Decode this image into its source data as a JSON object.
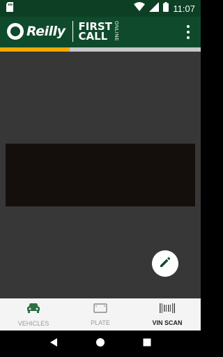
{
  "status_bar": {
    "time": "11:07"
  },
  "app_bar": {
    "logo_text": "Reilly",
    "first_line": "FIRST",
    "second_line": "CALL",
    "online_text": "ONLINE"
  },
  "bottom_nav": {
    "items": [
      {
        "label": "VEHICLES",
        "active": false
      },
      {
        "label": "PLATE",
        "active": false
      },
      {
        "label": "VIN SCAN",
        "active": true
      }
    ]
  },
  "colors": {
    "brand_green": "#0f4a2c",
    "accent_yellow": "#f4a900",
    "camera_bg": "#373737"
  },
  "icons": [
    "sd-card-icon",
    "wifi-icon",
    "cell-signal-icon",
    "battery-icon",
    "more-vert-icon",
    "pencil-icon",
    "car-icon",
    "license-plate-icon",
    "barcode-icon",
    "back-icon",
    "home-icon",
    "recents-icon"
  ]
}
